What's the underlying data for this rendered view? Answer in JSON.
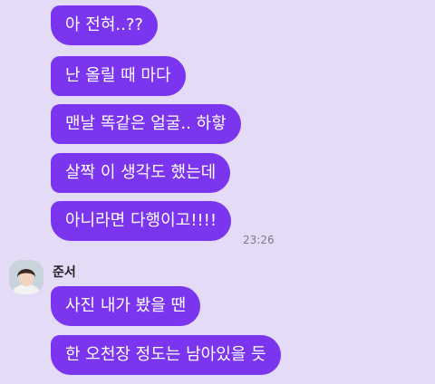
{
  "colors": {
    "background": "#e4dcf7",
    "bubble": "#7c35ee",
    "bubble_text": "#ffffff",
    "timestamp": "#7d7a86"
  },
  "messages_block_1": [
    "아 전혀..??",
    "난 올릴 때 마다",
    "맨날 똑같은 얼굴.. 하핳",
    "살짝 이 생각도 했는데",
    "아니라면 다행이고!!!!"
  ],
  "block_1_time": "23:26",
  "contact": {
    "name": "준서",
    "avatar_icon": "profile-photo-icon"
  },
  "messages_block_2": [
    "사진 내가 봤을 땐",
    "한 오천장 정도는 남아있을 듯"
  ]
}
